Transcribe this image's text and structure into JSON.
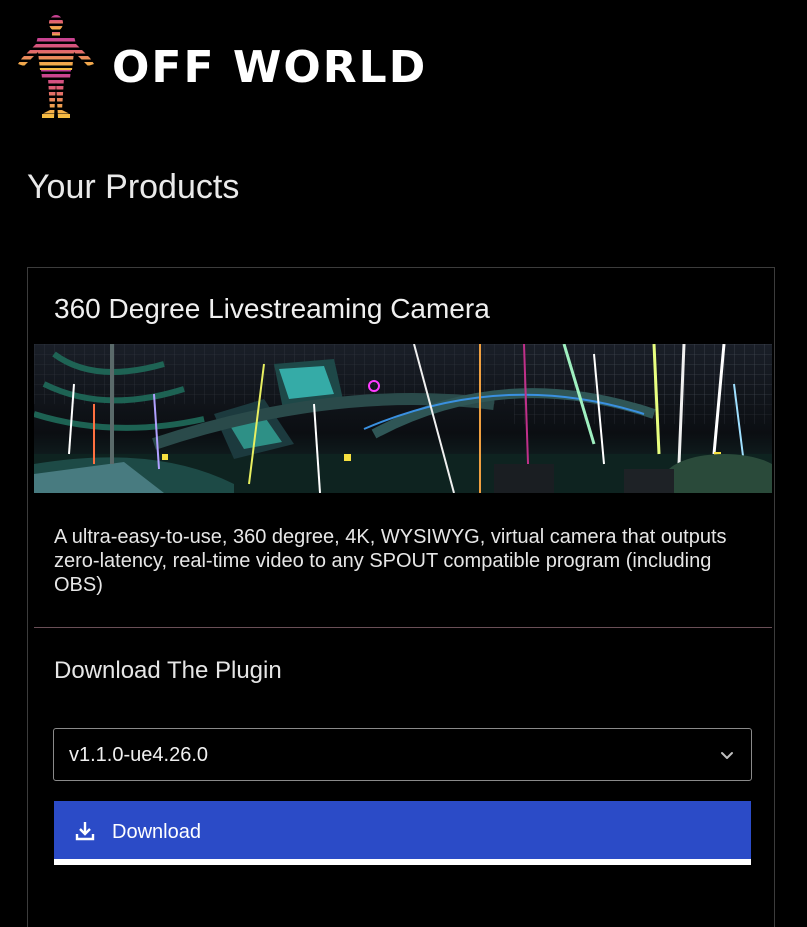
{
  "brand": {
    "name": "OFF WORLD"
  },
  "page": {
    "title": "Your Products"
  },
  "product": {
    "title": "360 Degree Livestreaming Camera",
    "description": "A ultra-easy-to-use, 360 degree, 4K, WYSIWYG, virtual camera that outputs zero-latency, real-time video to any SPOUT compatible program (including OBS)",
    "download_section_title": "Download The Plugin",
    "version_select": {
      "selected": "v1.1.0-ue4.26.0"
    },
    "download_button_label": "Download"
  },
  "colors": {
    "background": "#000000",
    "button": "#2b4bc7",
    "divider": "#6a4f57",
    "logo_gradient": [
      "#c23a9a",
      "#e06070",
      "#f0a050",
      "#f6c040"
    ]
  },
  "icons": {
    "logo": "human-figure-icon",
    "select_chevron": "chevron-down-icon",
    "download": "download-icon"
  }
}
